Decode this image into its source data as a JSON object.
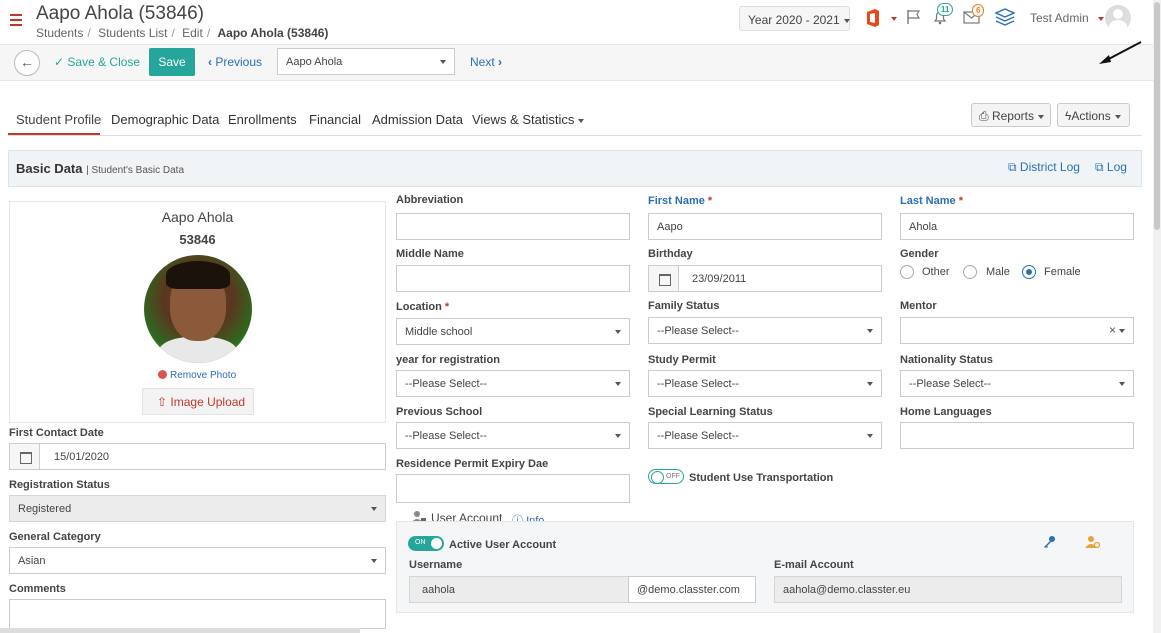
{
  "header": {
    "title": "Aapo Ahola (53846)",
    "breadcrumbs": [
      "Students",
      "Students List",
      "Edit"
    ],
    "breadcrumb_current": "Aapo Ahola (53846)",
    "year_selector": "Year 2020 - 2021",
    "notifications_count": "11",
    "messages_count": "6",
    "user_name": "Test Admin"
  },
  "toolbar": {
    "save_close_label": "Save & Close",
    "save_label": "Save",
    "previous_label": "Previous",
    "student_select_value": "Aapo Ahola",
    "next_label": "Next"
  },
  "tabs": [
    {
      "label": "Student Profile",
      "active": true
    },
    {
      "label": "Demographic Data"
    },
    {
      "label": "Enrollments"
    },
    {
      "label": "Financial"
    },
    {
      "label": "Admission Data"
    },
    {
      "label": "Views & Statistics"
    }
  ],
  "actions": {
    "reports_label": "Reports",
    "actions_label": "Actions"
  },
  "section": {
    "title": "Basic Data",
    "subtitle": "| Student's Basic Data",
    "district_log_label": "District Log",
    "log_label": "Log"
  },
  "profile": {
    "name": "Aapo Ahola",
    "id": "53846",
    "remove_photo_label": "Remove Photo",
    "upload_label": "Image Upload"
  },
  "left_fields": {
    "first_contact_label": "First Contact Date",
    "first_contact_value": "15/01/2020",
    "registration_status_label": "Registration Status",
    "registration_status_value": "Registered",
    "general_category_label": "General Category",
    "general_category_value": "Asian",
    "comments_label": "Comments"
  },
  "form": {
    "abbreviation_label": "Abbreviation",
    "first_name_label": "First Name",
    "first_name_value": "Aapo",
    "last_name_label": "Last Name",
    "last_name_value": "Ahola",
    "middle_name_label": "Middle Name",
    "birthday_label": "Birthday",
    "birthday_value": "23/09/2011",
    "gender_label": "Gender",
    "gender_options": [
      "Other",
      "Male",
      "Female"
    ],
    "gender_selected": "Female",
    "location_label": "Location",
    "location_value": "Middle school",
    "family_status_label": "Family Status",
    "family_status_value": "--Please Select--",
    "mentor_label": "Mentor",
    "mentor_clear": "×",
    "year_registration_label": "year for registration",
    "year_registration_value": "--Please Select--",
    "study_permit_label": "Study Permit",
    "study_permit_value": "--Please Select--",
    "nationality_label": "Nationality Status",
    "nationality_value": "--Please Select--",
    "previous_school_label": "Previous School",
    "previous_school_value": "--Please Select--",
    "special_learning_label": "Special Learning Status",
    "special_learning_value": "--Please Select--",
    "home_languages_label": "Home Languages",
    "residence_permit_label": "Residence Permit Expiry Dae",
    "transport_toggle": "OFF",
    "transport_label": "Student Use Transportation"
  },
  "user_account": {
    "title": "User Account",
    "info_label": "Info",
    "active_toggle": "ON",
    "active_label": "Active User Account",
    "username_label": "Username",
    "username_value": "aahola",
    "domain_value": "@demo.classter.com",
    "email_label": "E-mail Account",
    "email_value": "aahola@demo.classter.eu"
  },
  "colors": {
    "accent": "#26a69a",
    "link": "#2a6fb6",
    "brand_red": "#c0392b"
  }
}
